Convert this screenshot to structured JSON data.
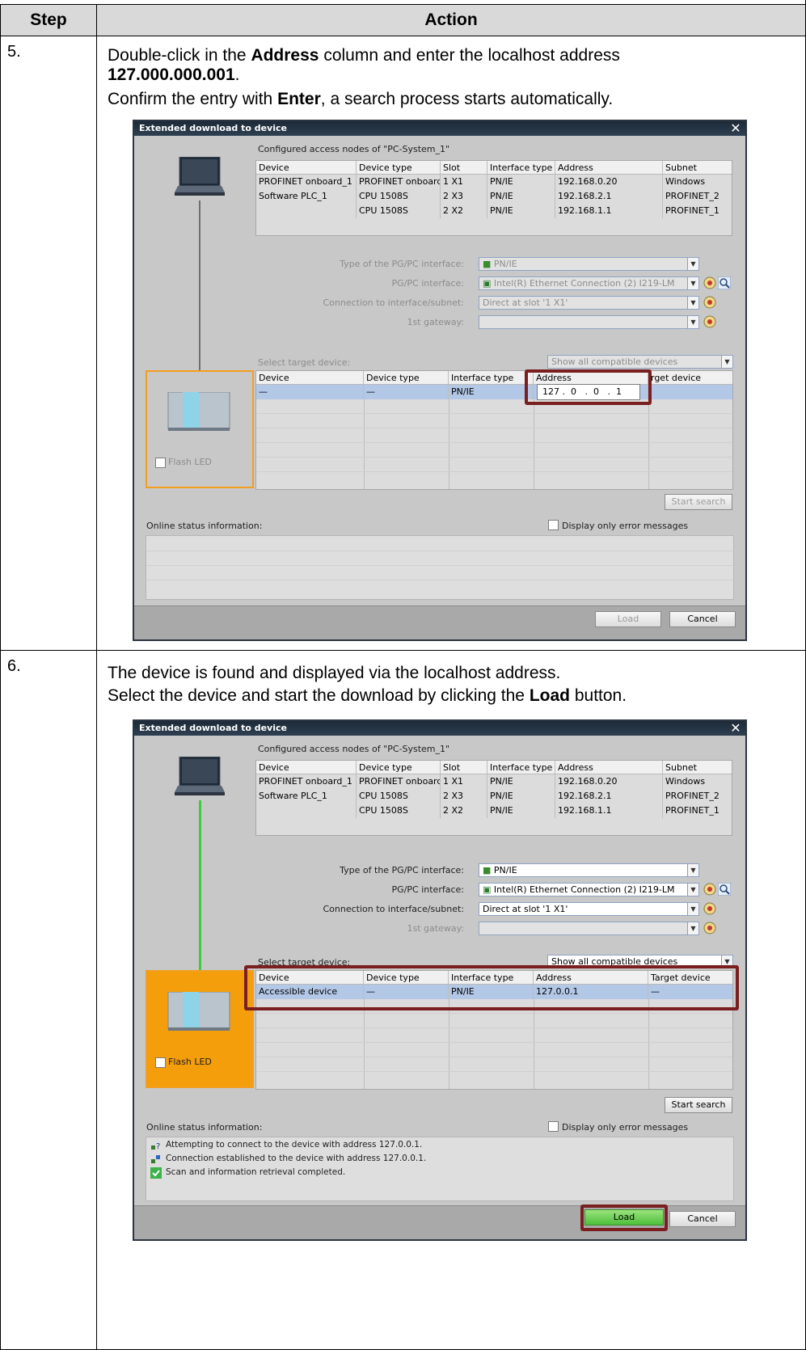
{
  "header": {
    "step": "Step",
    "action": "Action"
  },
  "steps": [
    {
      "number": "5.",
      "line1": "Double-click in the",
      "line1_bold": "Address",
      "line1_rest": "column and enter the localhost address",
      "line2_bold": "127.000.000.001",
      "line2_rest": ".",
      "line3": "Confirm the entry with",
      "line3_bold": "Enter",
      "line3_rest": ", a search process starts automatically."
    },
    {
      "number": "6.",
      "line1": "The device is found and displayed via the localhost address.",
      "line2": "Select the device and start the download by clicking the",
      "line2_bold": "Load",
      "line2_rest": "button."
    }
  ],
  "dialog": {
    "title": "Extended download to device",
    "close": "✕",
    "configured_label": "Configured access nodes of \"PC-System_1\"",
    "nodes_headers": [
      "Device",
      "Device type",
      "Slot",
      "Interface type",
      "Address",
      "Subnet"
    ],
    "nodes_rows": [
      [
        "PROFINET onboard_1",
        "PROFINET onboard",
        "1 X1",
        "PN/IE",
        "192.168.0.20",
        "Windows"
      ],
      [
        "Software PLC_1",
        "CPU 1508S",
        "2 X3",
        "PN/IE",
        "192.168.2.1",
        "PROFINET_2"
      ],
      [
        "",
        "CPU 1508S",
        "2 X2",
        "PN/IE",
        "192.168.1.1",
        "PROFINET_1"
      ]
    ],
    "pgpc_type_label": "Type of the PG/PC interface:",
    "pgpc_type_value": "PN/IE",
    "pgpc_if_label": "PG/PC interface:",
    "pgpc_if_value": "Intel(R) Ethernet Connection (2) I219-LM",
    "conn_label": "Connection to interface/subnet:",
    "conn_value": "Direct at slot '1 X1'",
    "gateway_label": "1st gateway:",
    "select_target_label": "Select target device:",
    "show_all": "Show all compatible devices",
    "target_headers": [
      "Device",
      "Device type",
      "Interface type",
      "Address",
      "Target device"
    ],
    "flash_led": "Flash LED",
    "start_search": "Start search",
    "online_status_label": "Online status information:",
    "display_errors": "Display only error messages",
    "load": "Load",
    "cancel": "Cancel"
  },
  "dialog1": {
    "target_row": [
      "—",
      "—",
      "PN/IE",
      "127 .  0   .  0   .  1",
      ""
    ],
    "target_header_5": "rget device"
  },
  "dialog2": {
    "target_row": [
      "Accessible device",
      "—",
      "PN/IE",
      "127.0.0.1",
      "—"
    ],
    "status_lines": [
      "Attempting to connect to the device with address 127.0.0.1.",
      "Connection established to the device with address 127.0.0.1.",
      "Scan and information retrieval completed."
    ]
  }
}
